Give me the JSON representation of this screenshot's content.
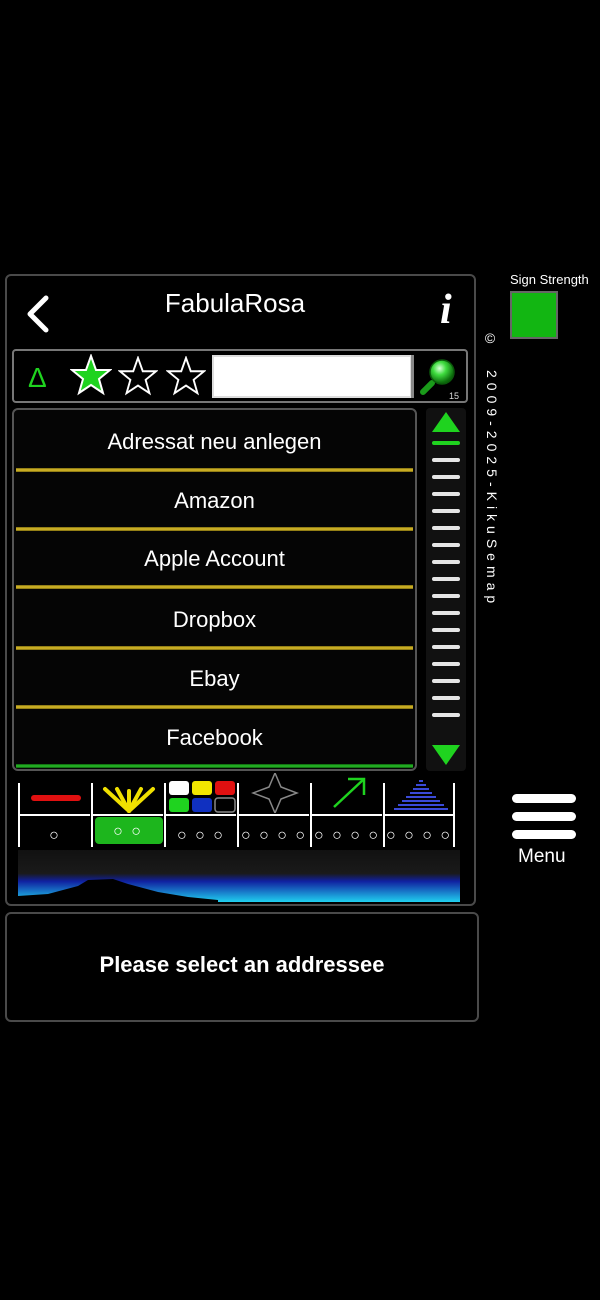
{
  "header": {
    "title": "FabulaRosa"
  },
  "toolbar": {
    "search_value": "",
    "search_count": "15"
  },
  "list": {
    "items": [
      {
        "label": "Adressat neu anlegen"
      },
      {
        "label": "Amazon"
      },
      {
        "label": "Apple Account"
      },
      {
        "label": "Dropbox"
      },
      {
        "label": "Ebay"
      },
      {
        "label": "Facebook"
      }
    ]
  },
  "sidebar": {
    "sign_strength_label": "Sign Strength",
    "copyright_symbol": "©",
    "copyright_text": "2009-2025-KikuSemap",
    "menu_label": "Menu"
  },
  "status": {
    "message": "Please select an addressee"
  },
  "modes": {
    "selected_index": 1,
    "dots": [
      "○",
      "○ ○",
      "○ ○ ○",
      "○ ○ ○ ○",
      "○ ○ ○ ○",
      "○ ○ ○ ○"
    ]
  },
  "colors": {
    "accent_green": "#1fd31f",
    "gold_line": "#e1c12a",
    "sign_strength": "#12b612"
  }
}
